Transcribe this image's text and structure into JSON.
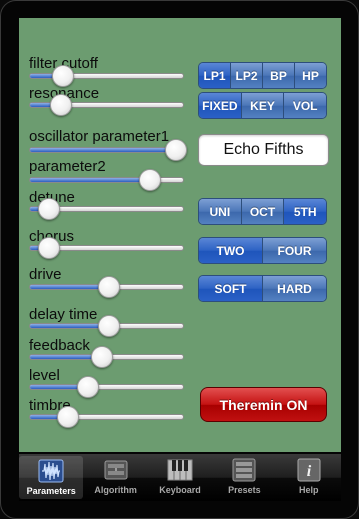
{
  "sliders": [
    {
      "label": "filter cutoff",
      "value": 0.16
    },
    {
      "label": "resonance",
      "value": 0.15
    },
    {
      "label": "oscillator parameter1",
      "value": 1.0
    },
    {
      "label": "parameter2",
      "value": 0.81
    },
    {
      "label": "detune",
      "value": 0.06
    },
    {
      "label": "chorus",
      "value": 0.06
    },
    {
      "label": "drive",
      "value": 0.5
    },
    {
      "label": "delay time",
      "value": 0.5
    },
    {
      "label": "feedback",
      "value": 0.45
    },
    {
      "label": "level",
      "value": 0.35
    },
    {
      "label": "timbre",
      "value": 0.2
    }
  ],
  "filter_type": {
    "options": [
      "LP1",
      "LP2",
      "BP",
      "HP"
    ],
    "selected": "LP1"
  },
  "filter_mode": {
    "options": [
      "FIXED",
      "KEY",
      "VOL"
    ],
    "selected": "FIXED"
  },
  "preset_name": "Echo Fifths",
  "voicing": {
    "options": [
      "UNI",
      "OCT",
      "5TH"
    ],
    "selected": "5TH"
  },
  "chorus_mode": {
    "options": [
      "TWO",
      "FOUR"
    ],
    "selected": "TWO"
  },
  "drive_mode": {
    "options": [
      "SOFT",
      "HARD"
    ],
    "selected": "SOFT"
  },
  "theremin_label": "Theremin ON",
  "colors": {
    "panel": "#6c9c70",
    "theremin": "#c41212",
    "segment": "#4b76b8",
    "segment_selected": "#2d62c4"
  },
  "tabs": [
    {
      "label": "Parameters",
      "icon": "waveform-icon",
      "selected": true
    },
    {
      "label": "Algorithm",
      "icon": "algorithm-icon",
      "selected": false
    },
    {
      "label": "Keyboard",
      "icon": "piano-keyboard-icon",
      "selected": false
    },
    {
      "label": "Presets",
      "icon": "presets-icon",
      "selected": false
    },
    {
      "label": "Help",
      "icon": "info-icon",
      "selected": false
    }
  ]
}
